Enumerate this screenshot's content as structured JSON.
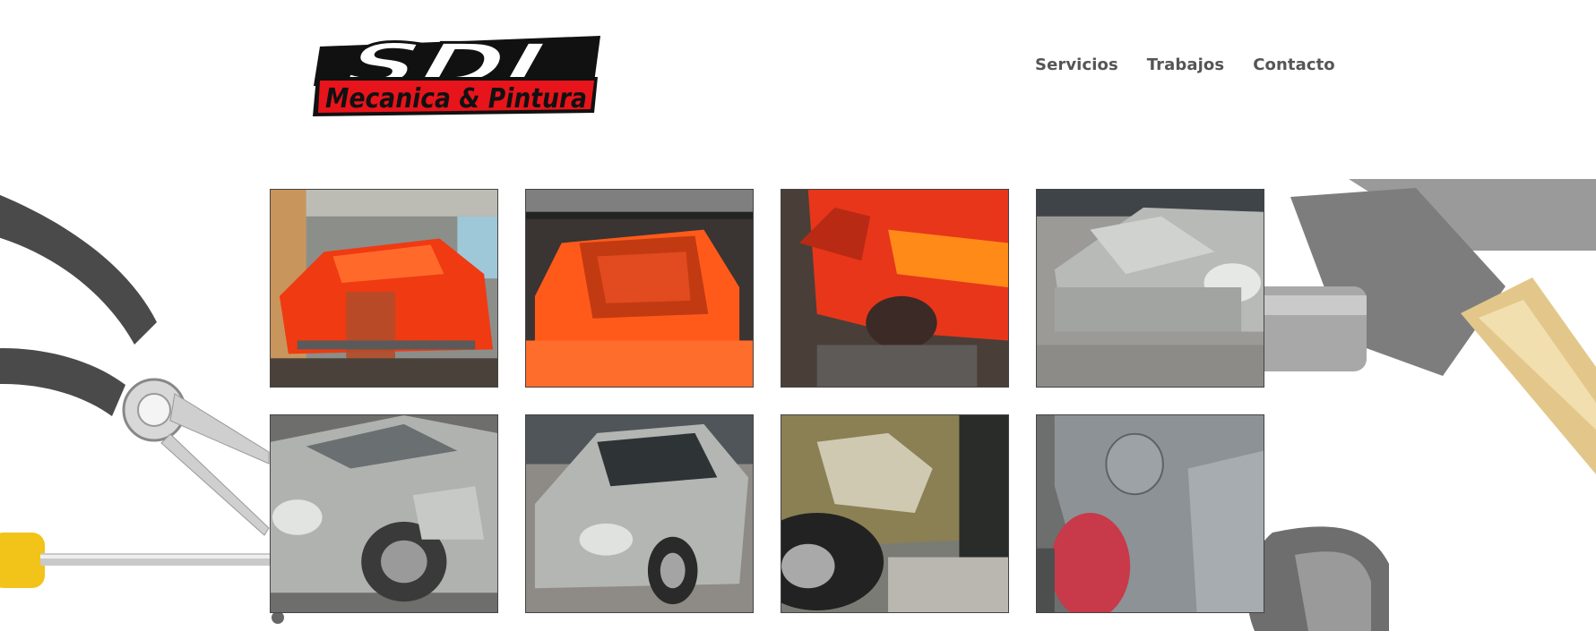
{
  "brand": {
    "logo_top": "SDL",
    "logo_bottom": "Mecanica & Pintura",
    "colors": {
      "red": "#e8141b",
      "black": "#111111"
    }
  },
  "nav": {
    "items": [
      {
        "label": "Servicios"
      },
      {
        "label": "Trabajos"
      },
      {
        "label": "Contacto"
      }
    ]
  },
  "gallery": {
    "items": [
      {
        "subject": "red car body on rotisserie in garage",
        "palette": "red"
      },
      {
        "subject": "orange car shell rear view under roof",
        "palette": "orange"
      },
      {
        "subject": "red painted car side panel",
        "palette": "red"
      },
      {
        "subject": "silver car front with primer patches",
        "palette": "silver"
      },
      {
        "subject": "silver hatchback front fender primer",
        "palette": "silver"
      },
      {
        "subject": "silver hatchback parked",
        "palette": "silver"
      },
      {
        "subject": "damaged gold car door and wheel",
        "palette": "gold"
      },
      {
        "subject": "grey rear quarter panel with fuel door",
        "palette": "grey"
      }
    ]
  },
  "decor": {
    "left": "pliers-and-screwdriver",
    "right": "hammer-and-wrench"
  }
}
